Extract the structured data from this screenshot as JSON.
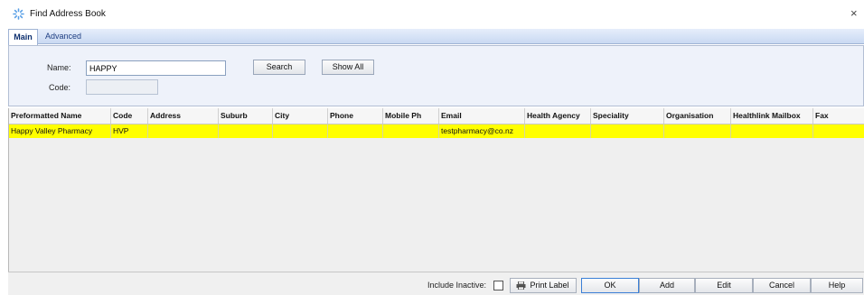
{
  "window": {
    "title": "Find Address Book",
    "close_glyph": "×",
    "icon": "spinner-icon",
    "accent": "#3b7fd6"
  },
  "tabs": [
    {
      "label": "Main",
      "active": true
    },
    {
      "label": "Advanced",
      "active": false
    }
  ],
  "search": {
    "name_label": "Name:",
    "name_value": "HAPPY",
    "code_label": "Code:",
    "code_value": "",
    "search_button": "Search",
    "show_all_button": "Show All"
  },
  "table": {
    "columns": [
      "Preformatted Name",
      "Code",
      "Address",
      "Suburb",
      "City",
      "Phone",
      "Mobile Ph",
      "Email",
      "Health Agency",
      "Speciality",
      "Organisation",
      "Healthlink Mailbox",
      "Fax"
    ],
    "rows": [
      {
        "selected": true,
        "selection_color": "#ffff00",
        "cells": [
          "Happy Valley Pharmacy",
          "HVP",
          "",
          "",
          "",
          "",
          "",
          "testpharmacy@co.nz",
          "",
          "",
          "",
          "",
          ""
        ]
      }
    ]
  },
  "footer": {
    "include_inactive_label": "Include Inactive:",
    "include_inactive_checked": false,
    "print_label_button": "Print Label",
    "print_icon": "printer-icon",
    "ok_button": "OK",
    "add_button": "Add",
    "edit_button": "Edit",
    "cancel_button": "Cancel",
    "help_button": "Help"
  }
}
